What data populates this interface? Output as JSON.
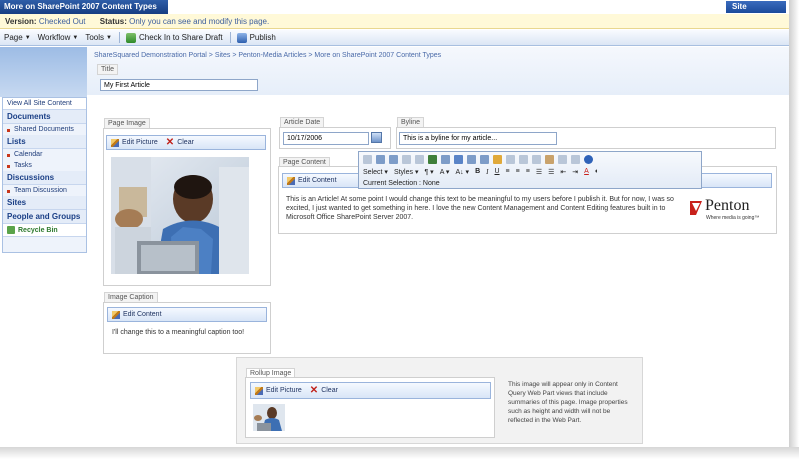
{
  "topbar": {
    "title": "More on SharePoint 2007 Content Types",
    "site_actions": "Site Actions"
  },
  "statusbar": {
    "version_label": "Version:",
    "version_value": "Checked Out",
    "status_label": "Status:",
    "status_value": "Only you can see and modify this page."
  },
  "toolbar": {
    "page": "Page",
    "workflow": "Workflow",
    "tools": "Tools",
    "checkin": "Check In to Share Draft",
    "publish": "Publish"
  },
  "nav": {
    "view_all": "View All Site Content",
    "documents": "Documents",
    "shared_documents": "Shared Documents",
    "lists": "Lists",
    "calendar": "Calendar",
    "tasks": "Tasks",
    "discussions": "Discussions",
    "team_discussion": "Team Discussion",
    "sites": "Sites",
    "people": "People and Groups",
    "recycle": "Recycle Bin"
  },
  "breadcrumb": "ShareSquared Demonstration Portal > Sites > Penton-Media Articles > More on SharePoint 2007 Content Types",
  "title_field": {
    "label": "Title",
    "value": "My First Article"
  },
  "page_image": {
    "label": "Page Image",
    "edit": "Edit Picture",
    "clear": "Clear"
  },
  "article_date": {
    "label": "Article Date",
    "value": "10/17/2006"
  },
  "byline": {
    "label": "Byline",
    "value": "This is a byline for my article..."
  },
  "page_content": {
    "label": "Page Content",
    "edit": "Edit Content",
    "text": "This is an Article!  At some point I would change this text to be meaningful to my users before I publish it.  But for now, I was so excited, I just wanted to get something in here.  I love the new Content Management and Content Editing features built in to Microsoft Office SharePoint Server 2007."
  },
  "rte": {
    "select": "Select",
    "styles": "Styles",
    "selection": "Current Selection : None"
  },
  "logo": {
    "name": "Penton",
    "tagline": "Where media is going™"
  },
  "image_caption": {
    "label": "Image Caption",
    "edit": "Edit Content",
    "text": "I'll change this to a meaningful caption too!"
  },
  "rollup": {
    "label": "Rollup Image",
    "edit": "Edit Picture",
    "clear": "Clear",
    "note": "This image will appear only in Content Query Web Part views that include summaries of this page. Image properties such as height and width will not be reflected in the Web Part."
  },
  "colors": {
    "accent": "#2f5ea8",
    "status_bg": "#fff9d8",
    "nav_bg": "#eef3fb"
  }
}
